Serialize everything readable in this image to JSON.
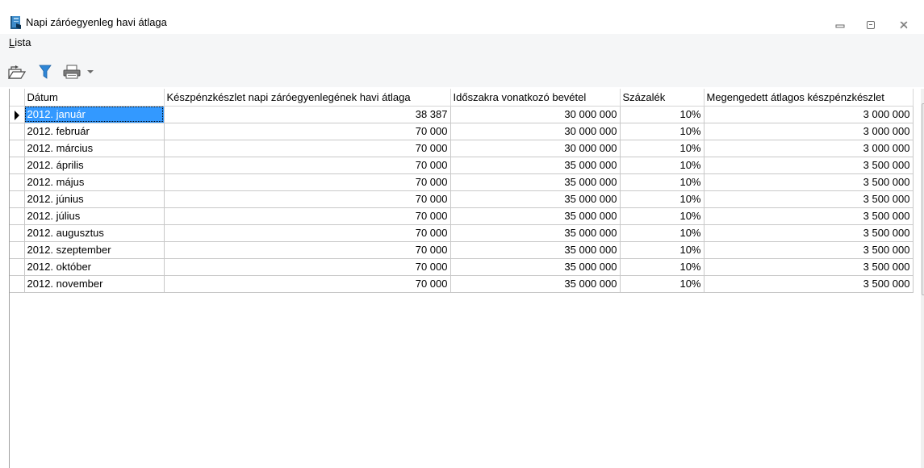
{
  "window": {
    "title": "Napi záróegyenleg havi átlaga",
    "app_icon": "ledger-book-icon",
    "controls": [
      "minimize-icon",
      "maximize-icon",
      "close-icon"
    ]
  },
  "menu": {
    "lista_accel": "L",
    "lista_rest": "ista"
  },
  "toolbar": {
    "icons": [
      "open-folder-icon",
      "filter-icon",
      "printer-icon",
      "dropdown-arrow-icon"
    ]
  },
  "table": {
    "columns": [
      "Dátum",
      "Készpénzkészlet napi záróegyenlegének havi átlaga",
      "Időszakra vonatkozó bevétel",
      "Százalék",
      "Megengedett átlagos készpénzkészlet"
    ],
    "rows": [
      [
        "2012. január",
        "38 387",
        "30 000 000",
        "10%",
        "3 000 000"
      ],
      [
        "2012. február",
        "70 000",
        "30 000 000",
        "10%",
        "3 000 000"
      ],
      [
        "2012. március",
        "70 000",
        "30 000 000",
        "10%",
        "3 000 000"
      ],
      [
        "2012. április",
        "70 000",
        "35 000 000",
        "10%",
        "3 500 000"
      ],
      [
        "2012. május",
        "70 000",
        "35 000 000",
        "10%",
        "3 500 000"
      ],
      [
        "2012. június",
        "70 000",
        "35 000 000",
        "10%",
        "3 500 000"
      ],
      [
        "2012. július",
        "70 000",
        "35 000 000",
        "10%",
        "3 500 000"
      ],
      [
        "2012. augusztus",
        "70 000",
        "35 000 000",
        "10%",
        "3 500 000"
      ],
      [
        "2012. szeptember",
        "70 000",
        "35 000 000",
        "10%",
        "3 500 000"
      ],
      [
        "2012. október",
        "70 000",
        "35 000 000",
        "10%",
        "3 500 000"
      ],
      [
        "2012. november",
        "70 000",
        "35 000 000",
        "10%",
        "3 500 000"
      ]
    ],
    "selected_row": 0
  },
  "colors": {
    "selection": "#3399ff",
    "toolbar_bg": "#f5f6f7"
  }
}
